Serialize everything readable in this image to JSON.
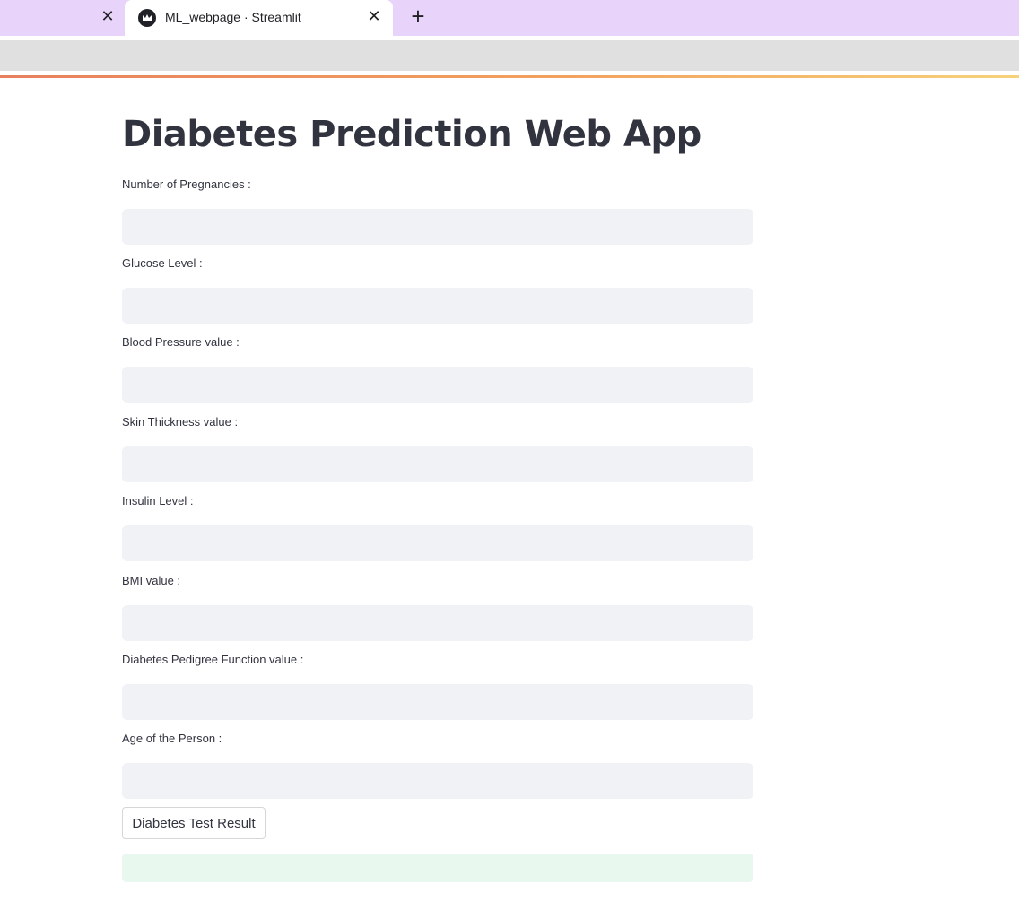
{
  "browser": {
    "tab": {
      "title": "ML_webpage · Streamlit",
      "favicon": "streamlit-crown-icon"
    },
    "close_glyph": "✕",
    "new_tab_glyph": "+"
  },
  "app": {
    "title": "Diabetes Prediction Web App",
    "fields": [
      {
        "label": "Number of Pregnancies :",
        "value": ""
      },
      {
        "label": "Glucose Level :",
        "value": ""
      },
      {
        "label": "Blood Pressure value :",
        "value": ""
      },
      {
        "label": "Skin Thickness value :",
        "value": ""
      },
      {
        "label": "Insulin Level :",
        "value": ""
      },
      {
        "label": "BMI value :",
        "value": ""
      },
      {
        "label": "Diabetes Pedigree Function value :",
        "value": ""
      },
      {
        "label": "Age of the Person :",
        "value": ""
      }
    ],
    "submit_label": "Diabetes Test Result",
    "result_text": ""
  },
  "colors": {
    "tabstrip": "#e8d3fb",
    "toolbar": "#e0e0e1",
    "input_bg": "#f0f2f6",
    "text": "#31333f",
    "success_bg": "#e8f8ee",
    "decoration_start": "#e8805e",
    "decoration_end": "#f7d27a"
  }
}
